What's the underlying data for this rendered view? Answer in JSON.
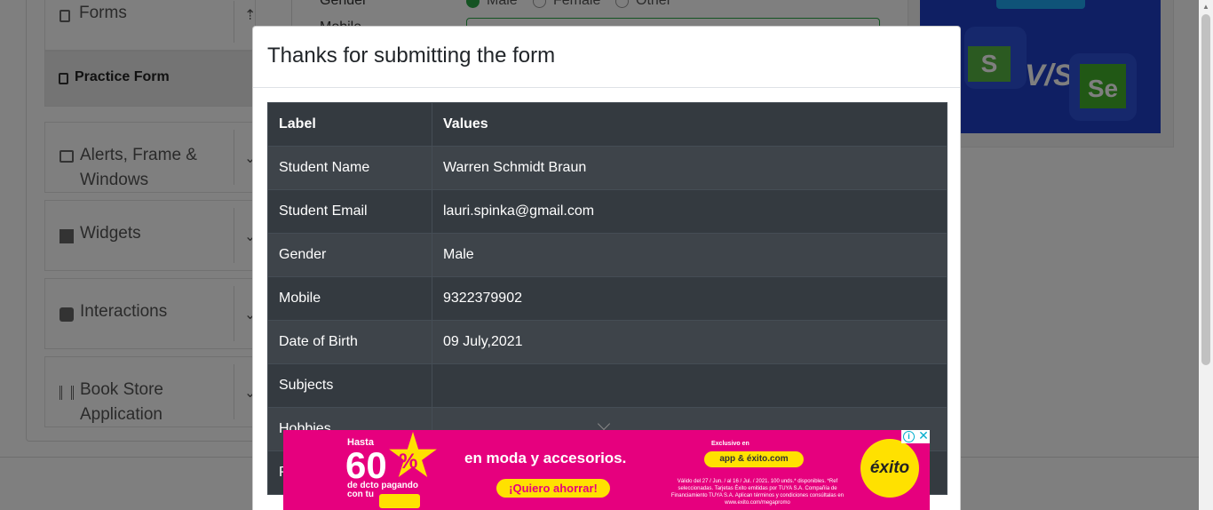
{
  "sidebar": {
    "forms_label": "Forms",
    "practice_form_label": "Practice Form",
    "groups": [
      {
        "label_line1": "Alerts, Frame &",
        "label_line2": "Windows"
      },
      {
        "label_line1": "Widgets"
      },
      {
        "label_line1": "Interactions"
      },
      {
        "label_line1": "Book Store",
        "label_line2": "Application"
      }
    ]
  },
  "background_form": {
    "gender_label": "Gender",
    "mobile_label": "Mobile",
    "gender_options": [
      "Male",
      "Female",
      "Other"
    ]
  },
  "side_ad": {
    "vs_text": "V/S",
    "s_text": "S",
    "se_text": "Se"
  },
  "modal": {
    "title": "Thanks for submitting the form",
    "columns": [
      "Label",
      "Values"
    ],
    "rows": [
      {
        "label": "Student Name",
        "value": "Warren Schmidt Braun"
      },
      {
        "label": "Student Email",
        "value": "lauri.spinka@gmail.com"
      },
      {
        "label": "Gender",
        "value": "Male"
      },
      {
        "label": "Mobile",
        "value": "9322379902"
      },
      {
        "label": "Date of Birth",
        "value": "09 July,2021"
      },
      {
        "label": "Subjects",
        "value": ""
      },
      {
        "label": "Hobbies",
        "value": ""
      },
      {
        "label": "P",
        "value": ""
      }
    ]
  },
  "ad": {
    "hasta": "Hasta",
    "percent": "60",
    "percent_sign": "%",
    "dcto": "de dcto pagando con tu",
    "headline": "en moda y accesorios.",
    "cta": "¡Quiero ahorrar!",
    "exclusive": "Exclusivo en",
    "app_badge": "app & éxito.com",
    "fine_print": "Válido del 27 / Jun. / al 16 / Jul. / 2021. 100 unds.* disponibles. *Ref seleccionadas. Tarjetas Éxito emitidas por TUYA S.A. Compañía de Financiamiento TUYA S.A. Aplican términos y condiciones consúltalas en www.exito.com/megapromo",
    "logo": "éxito",
    "info_icon": "i",
    "close_icon": "✕"
  },
  "colors": {
    "overlay": "rgba(0,0,0,0.5)",
    "table_dark": "#343a40",
    "ad_pink": "#e6007e",
    "ad_yellow": "#ffe100"
  }
}
